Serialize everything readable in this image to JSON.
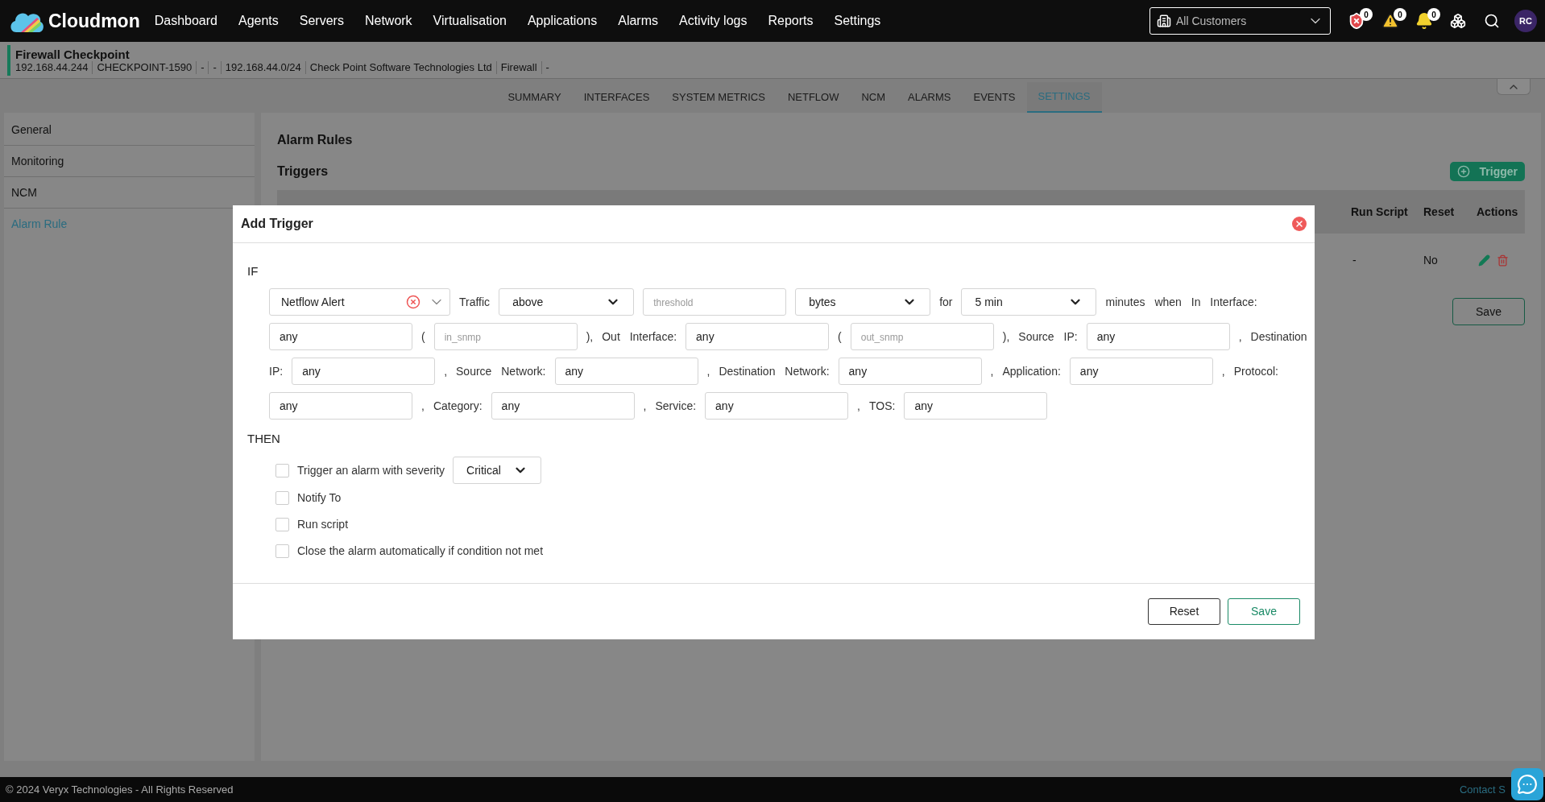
{
  "navbar": {
    "brand": "Cloudmon",
    "menu": [
      "Dashboard",
      "Agents",
      "Servers",
      "Network",
      "Virtualisation",
      "Applications",
      "Alarms",
      "Activity logs",
      "Reports",
      "Settings"
    ],
    "customer_select": "All Customers",
    "badges": [
      {
        "kind": "security",
        "count": "0"
      },
      {
        "kind": "warning",
        "count": "0"
      },
      {
        "kind": "bell",
        "count": "0"
      }
    ],
    "avatar": "RC"
  },
  "device": {
    "name": "Firewall Checkpoint",
    "details": [
      "192.168.44.244",
      "CHECKPOINT-1590",
      "-",
      "-",
      "192.168.44.0/24",
      "Check Point Software Technologies Ltd",
      "Firewall",
      "-"
    ]
  },
  "tabs": [
    {
      "label": "SUMMARY",
      "selected": false
    },
    {
      "label": "INTERFACES",
      "selected": false
    },
    {
      "label": "SYSTEM METRICS",
      "selected": false
    },
    {
      "label": "NETFLOW",
      "selected": false
    },
    {
      "label": "NCM",
      "selected": false
    },
    {
      "label": "ALARMS",
      "selected": false
    },
    {
      "label": "EVENTS",
      "selected": false
    },
    {
      "label": "SETTINGS",
      "selected": true
    }
  ],
  "sidebar": [
    {
      "label": "General",
      "selected": false
    },
    {
      "label": "Monitoring",
      "selected": false
    },
    {
      "label": "NCM",
      "selected": false
    },
    {
      "label": "Alarm Rule",
      "selected": true
    }
  ],
  "main": {
    "title": "Alarm Rules",
    "section": "Triggers",
    "add_button": "Trigger",
    "table": {
      "columns": [
        "Run Script",
        "Reset",
        "Actions"
      ],
      "rows": [
        [
          "-",
          "No"
        ]
      ]
    },
    "save_button": "Save"
  },
  "modal": {
    "title": "Add Trigger",
    "if_label": "IF",
    "condition_rows": [
      [
        {
          "kind": "combo",
          "value": "Netflow Alert"
        },
        {
          "kind": "text",
          "text": "Traffic"
        },
        {
          "kind": "select",
          "value": "above"
        },
        {
          "kind": "input",
          "placeholder": "threshold"
        },
        {
          "kind": "select",
          "value": "bytes"
        },
        {
          "kind": "text",
          "text": "for"
        },
        {
          "kind": "select",
          "value": "5 min"
        },
        {
          "kind": "text",
          "text": "minutes when In Interface:"
        }
      ],
      [
        {
          "kind": "input",
          "value": "any"
        },
        {
          "kind": "text",
          "text": "("
        },
        {
          "kind": "input",
          "placeholder": "in_snmp"
        },
        {
          "kind": "text",
          "text": "),"
        },
        {
          "kind": "text",
          "text": "Out Interface:"
        },
        {
          "kind": "input",
          "value": "any"
        },
        {
          "kind": "text",
          "text": "("
        },
        {
          "kind": "input",
          "placeholder": "out_snmp"
        },
        {
          "kind": "text",
          "text": "),"
        },
        {
          "kind": "text",
          "text": "Source IP:"
        },
        {
          "kind": "input",
          "value": "any"
        },
        {
          "kind": "text",
          "text": ","
        },
        {
          "kind": "text",
          "text": "Destination"
        }
      ],
      [
        {
          "kind": "text",
          "text": "IP:"
        },
        {
          "kind": "input",
          "value": "any"
        },
        {
          "kind": "text",
          "text": ","
        },
        {
          "kind": "text",
          "text": "Source Network:"
        },
        {
          "kind": "input",
          "value": "any"
        },
        {
          "kind": "text",
          "text": ","
        },
        {
          "kind": "text",
          "text": "Destination Network:"
        },
        {
          "kind": "input",
          "value": "any"
        },
        {
          "kind": "text",
          "text": ","
        },
        {
          "kind": "text",
          "text": "Application:"
        },
        {
          "kind": "input",
          "value": "any"
        },
        {
          "kind": "text",
          "text": ","
        },
        {
          "kind": "text",
          "text": "Protocol:"
        }
      ],
      [
        {
          "kind": "input",
          "value": "any"
        },
        {
          "kind": "text",
          "text": ","
        },
        {
          "kind": "text",
          "text": "Category:"
        },
        {
          "kind": "input",
          "value": "any"
        },
        {
          "kind": "text",
          "text": ","
        },
        {
          "kind": "text",
          "text": "Service:"
        },
        {
          "kind": "input",
          "value": "any"
        },
        {
          "kind": "text",
          "text": ","
        },
        {
          "kind": "text",
          "text": "TOS:"
        },
        {
          "kind": "input",
          "value": "any"
        }
      ]
    ],
    "then_label": "THEN",
    "actions": [
      {
        "label": "Trigger an alarm with severity",
        "checked": false,
        "select": "Critical"
      },
      {
        "label": "Notify To",
        "checked": false
      },
      {
        "label": "Run script",
        "checked": false
      },
      {
        "label": "Close the alarm automatically if condition not met",
        "checked": false
      }
    ],
    "buttons": [
      {
        "label": "Reset",
        "kind": "secondary"
      },
      {
        "label": "Save",
        "kind": "primary"
      }
    ]
  },
  "footer": {
    "copyright": "© 2024 Veryx Technologies - All Rights Reserved",
    "link": "Contact S"
  }
}
